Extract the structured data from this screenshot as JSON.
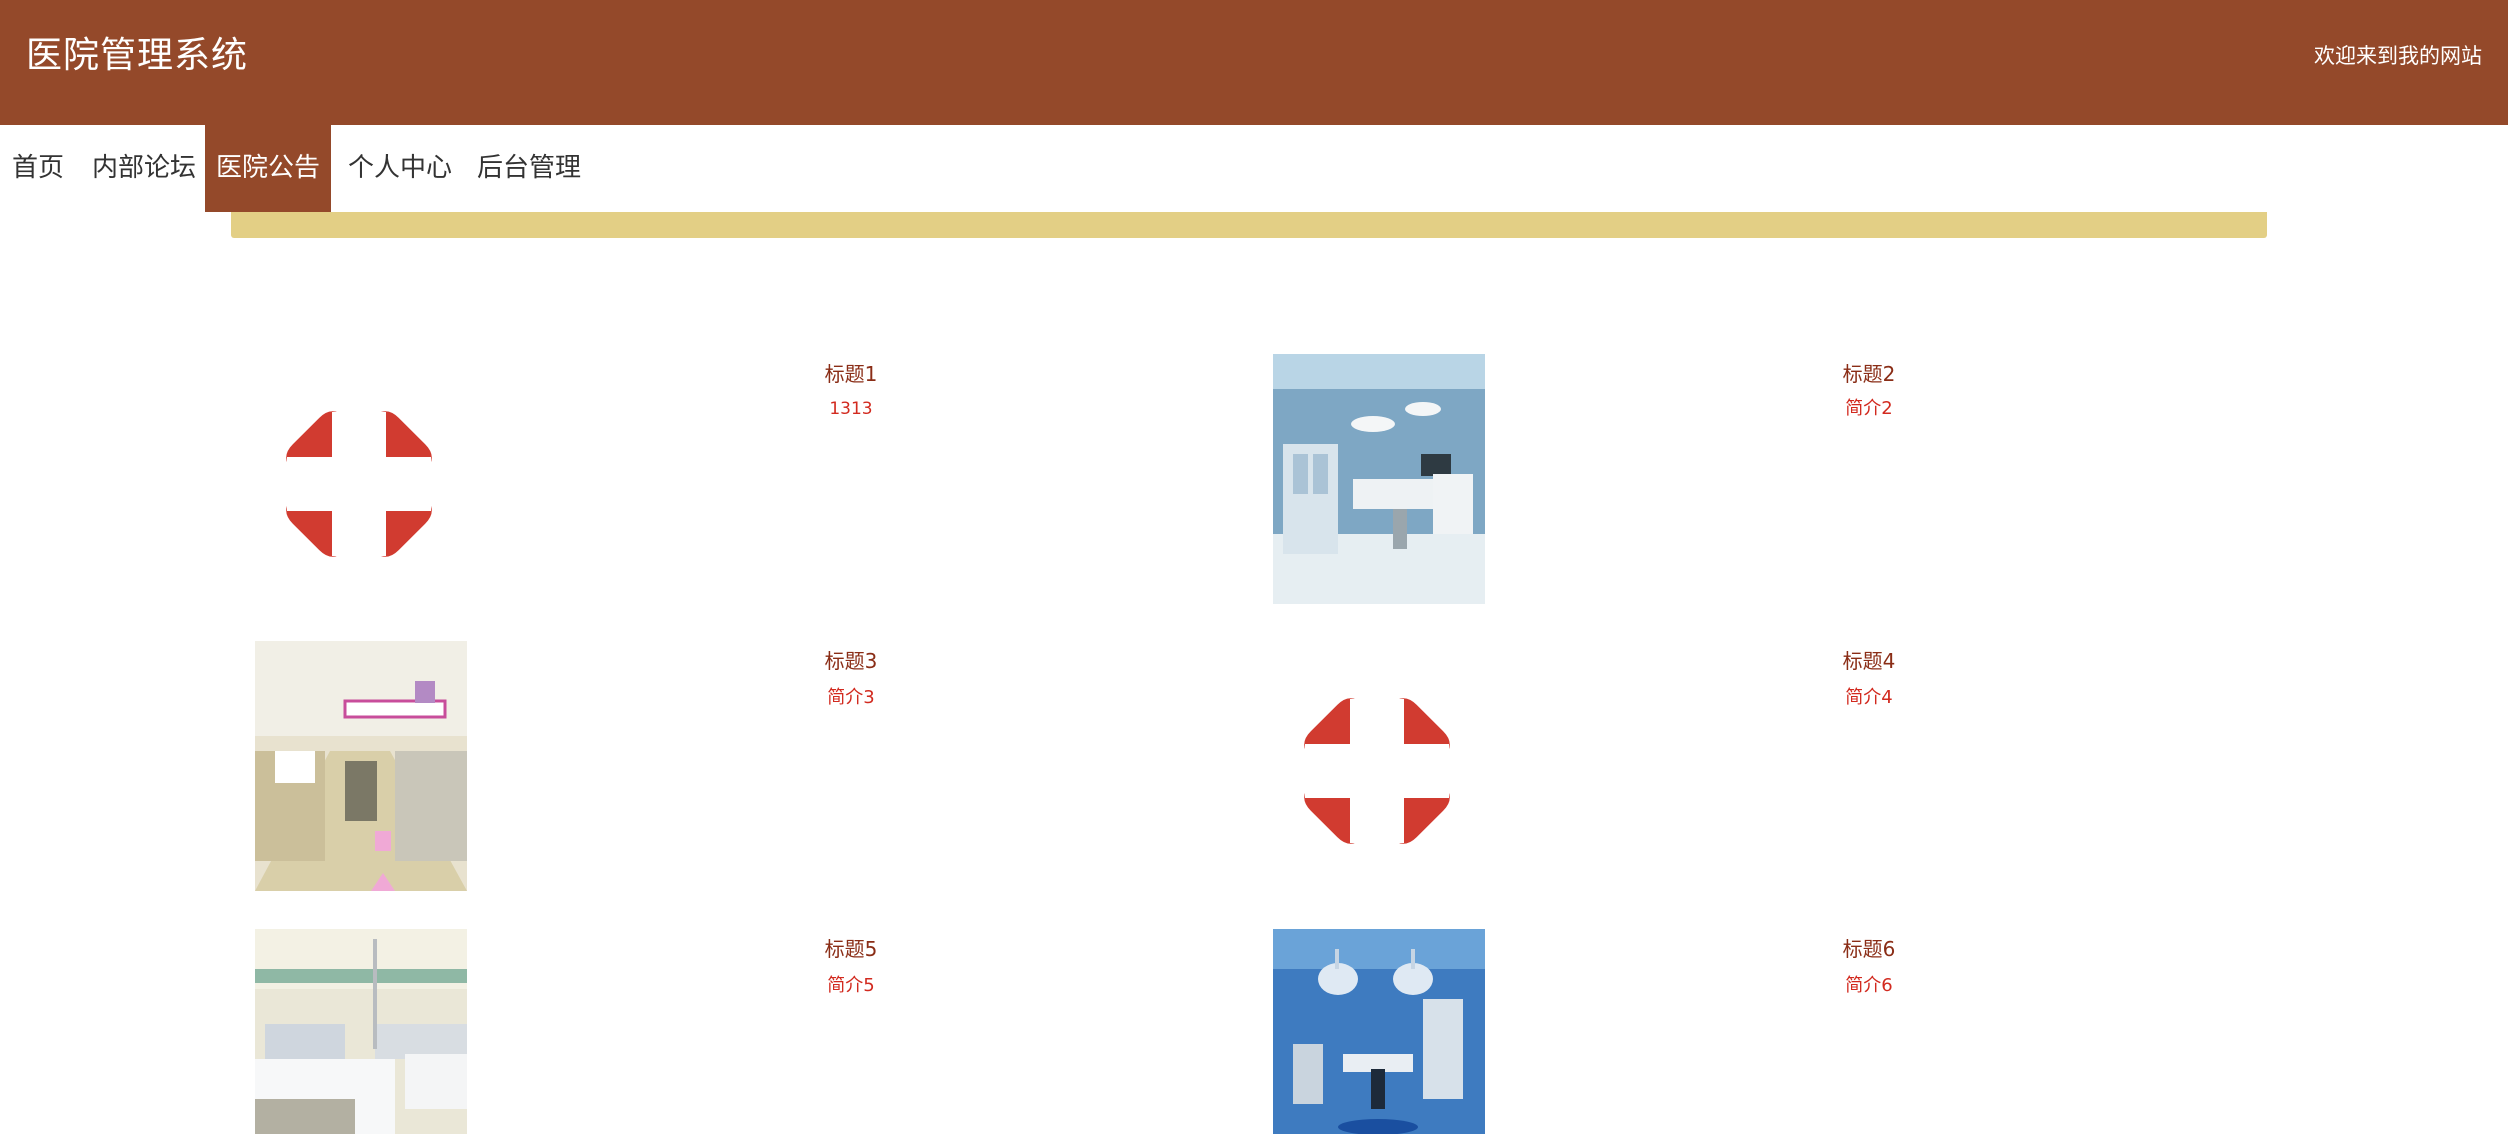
{
  "header": {
    "title": "医院管理系统",
    "welcome": "欢迎来到我的网站"
  },
  "nav": {
    "items": [
      {
        "label": "首页"
      },
      {
        "label": "内部论坛"
      },
      {
        "label": "医院公告",
        "active": true
      },
      {
        "label": "个人中心"
      },
      {
        "label": "后台管理"
      }
    ]
  },
  "notices": [
    {
      "title": "标题1",
      "desc": "1313",
      "image": "red-cross-logo"
    },
    {
      "title": "标题2",
      "desc": "简介2",
      "image": "operating-room-photo"
    },
    {
      "title": "标题3",
      "desc": "简介3",
      "image": "hospital-corridor-photo"
    },
    {
      "title": "标题4",
      "desc": "简介4",
      "image": "red-cross-logo"
    },
    {
      "title": "标题5",
      "desc": "简介5",
      "image": "hospital-ward-photo"
    },
    {
      "title": "标题6",
      "desc": "简介6",
      "image": "surgery-theater-photo"
    }
  ],
  "colors": {
    "header_bg": "#94492a",
    "banner_bg": "#e3cf85",
    "title_text": "#8a2d16",
    "desc_text": "#d22a1f",
    "cross_red": "#d13b30"
  }
}
